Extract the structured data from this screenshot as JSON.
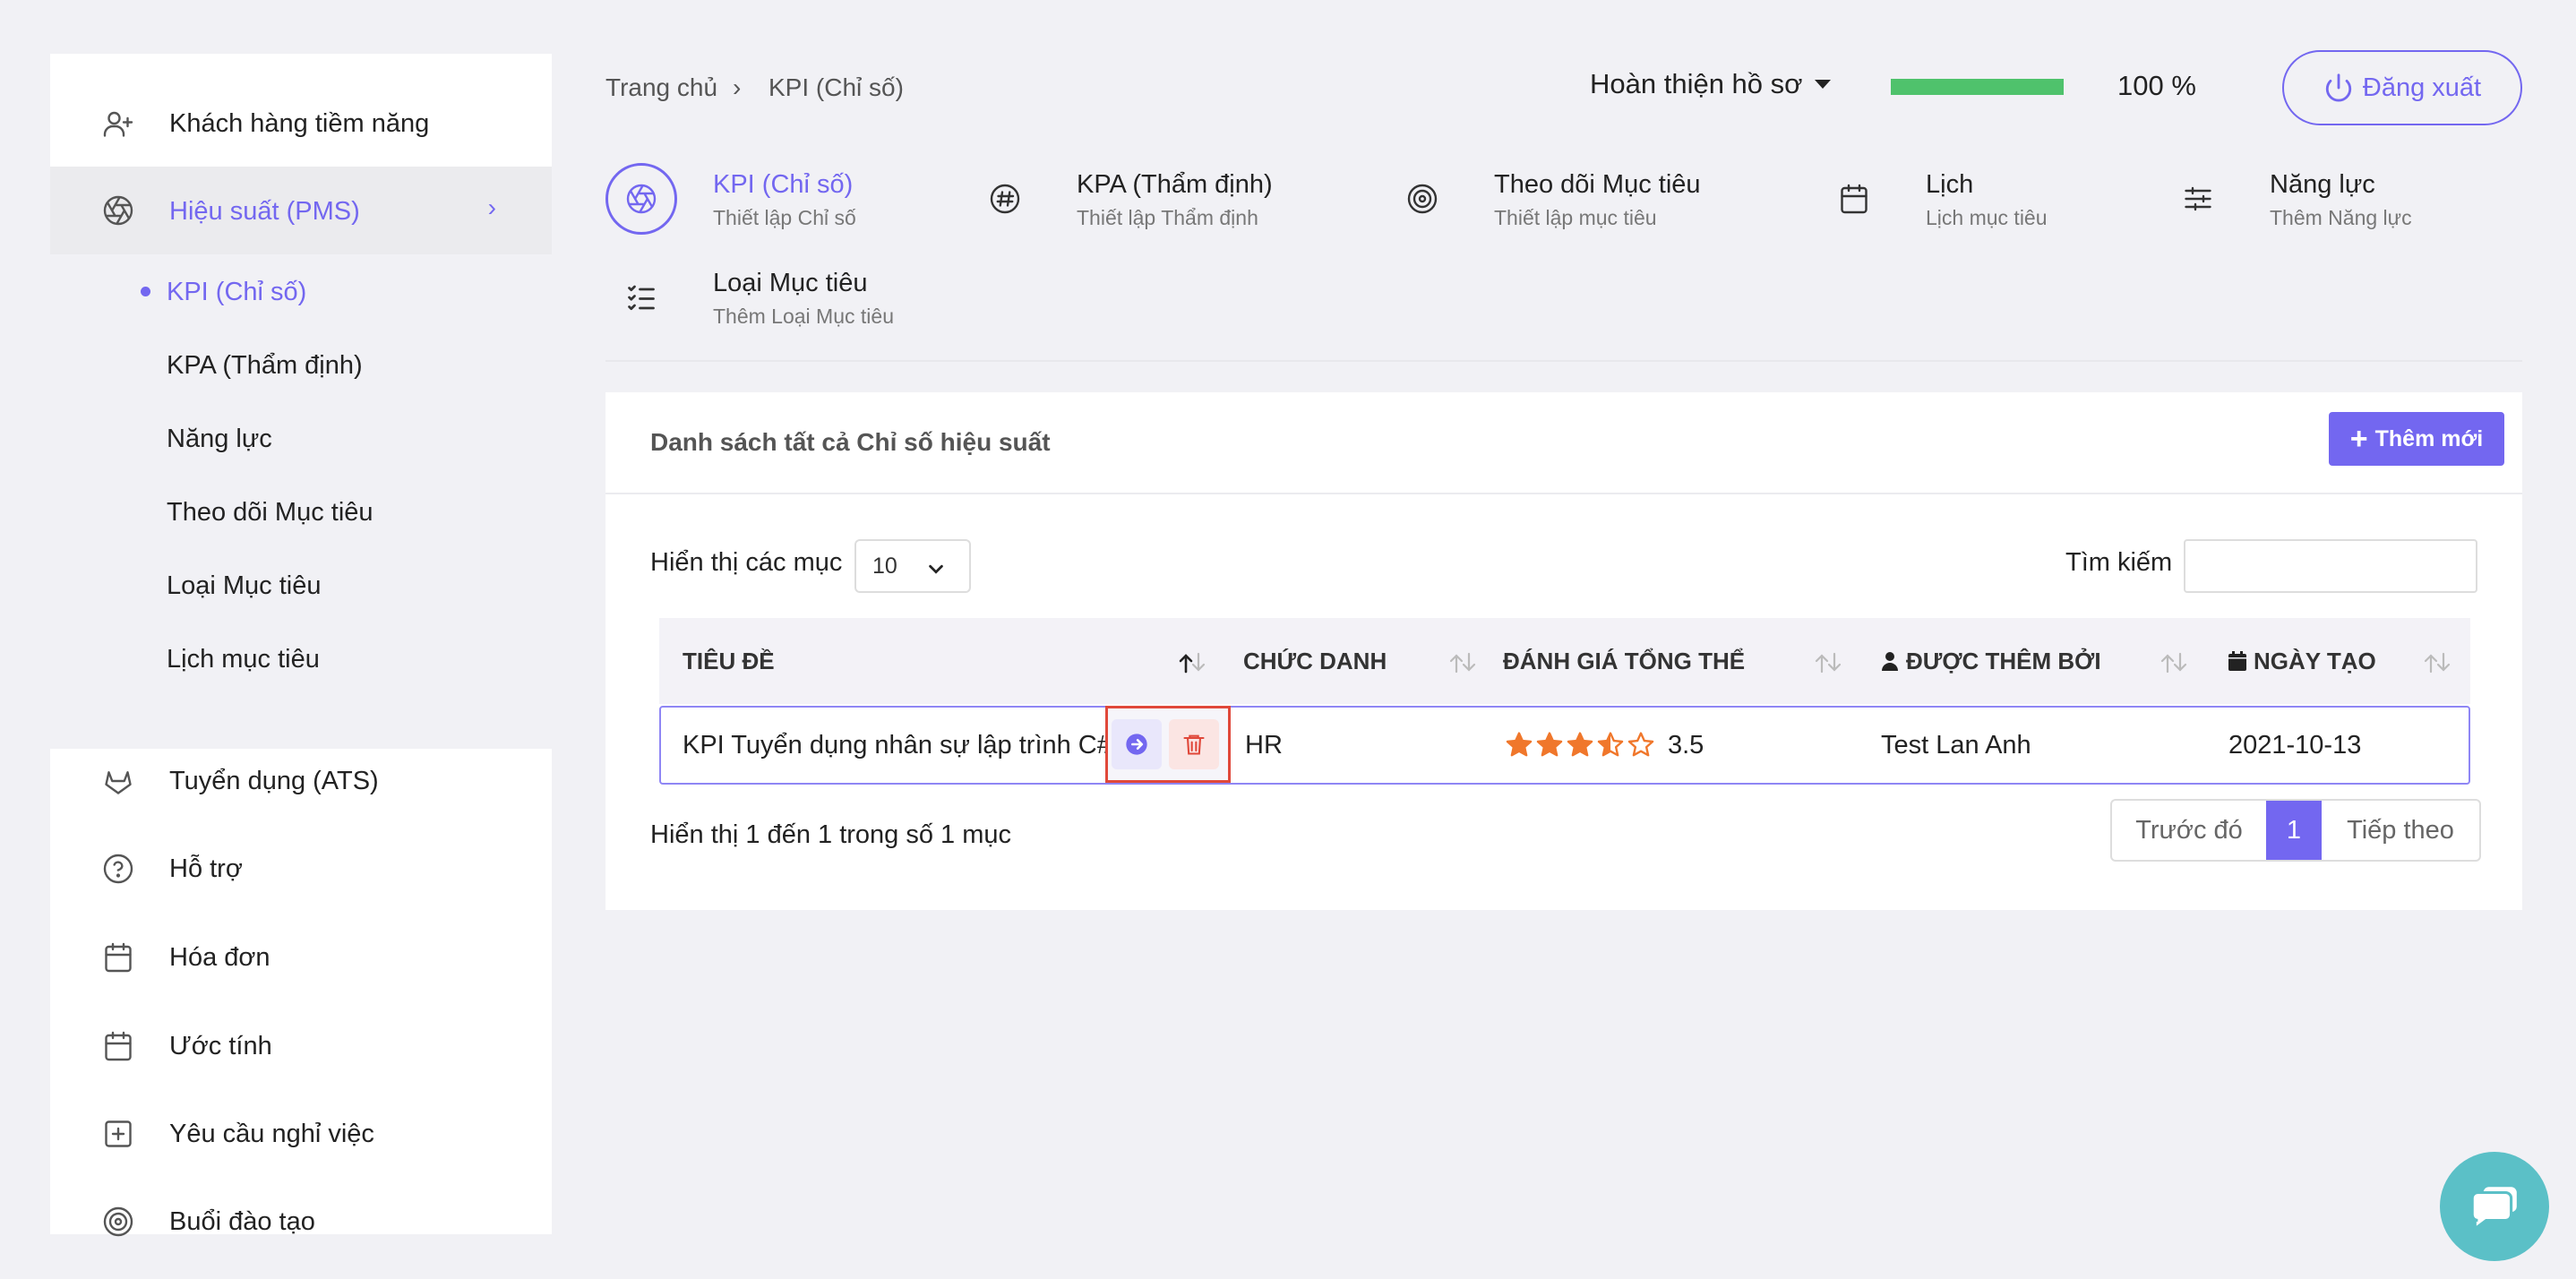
{
  "sidebar": {
    "items": [
      {
        "label": "Khách hàng tiềm năng",
        "icon": "user-plus-icon"
      },
      {
        "label": "Hiệu suất (PMS)",
        "icon": "aperture-icon"
      },
      {
        "label": "Tuyển dụng (ATS)",
        "icon": "gitlab-icon"
      },
      {
        "label": "Hỗ trợ",
        "icon": "help-circle-icon"
      },
      {
        "label": "Hóa đơn",
        "icon": "calendar-icon"
      },
      {
        "label": "Ước tính",
        "icon": "calendar-icon"
      },
      {
        "label": "Yêu cầu nghỉ việc",
        "icon": "plus-square-icon"
      },
      {
        "label": "Buổi đào tạo",
        "icon": "target-icon"
      }
    ],
    "sub_items": [
      {
        "label": "KPI (Chỉ số)"
      },
      {
        "label": "KPA (Thẩm định)"
      },
      {
        "label": "Năng lực"
      },
      {
        "label": "Theo dõi Mục tiêu"
      },
      {
        "label": "Loại Mục tiêu"
      },
      {
        "label": "Lịch mục tiêu"
      }
    ]
  },
  "breadcrumb": {
    "home": "Trang chủ",
    "separator": "›",
    "current": "KPI (Chỉ số)"
  },
  "header": {
    "profile_label": "Hoàn thiện hồ sơ",
    "progress_fraction": 1.0,
    "progress_text": "100 %",
    "logout_label": "Đăng xuất"
  },
  "tabs": [
    {
      "title": "KPI (Chỉ số)",
      "subtitle": "Thiết lập Chỉ số",
      "icon": "aperture-icon"
    },
    {
      "title": "KPA (Thẩm định)",
      "subtitle": "Thiết lập Thẩm định",
      "icon": "hash-icon"
    },
    {
      "title": "Theo dõi Mục tiêu",
      "subtitle": "Thiết lập mục tiêu",
      "icon": "target-icon"
    },
    {
      "title": "Lịch",
      "subtitle": "Lịch mục tiêu",
      "icon": "calendar-icon"
    },
    {
      "title": "Năng lực",
      "subtitle": "Thêm Năng lực",
      "icon": "sliders-icon"
    },
    {
      "title": "Loại Mục tiêu",
      "subtitle": "Thêm Loại Mục tiêu",
      "icon": "list-check-icon"
    }
  ],
  "card": {
    "title": "Danh sách tất cả Chỉ số hiệu suất",
    "add_label": "Thêm mới",
    "show_label": "Hiển thị các mục",
    "page_size": "10",
    "search_label": "Tìm kiếm",
    "search_value": ""
  },
  "table": {
    "columns": [
      "TIÊU ĐỀ",
      "CHỨC DANH",
      "ĐÁNH GIÁ TỔNG THỂ",
      "ĐƯỢC THÊM BỞI",
      "NGÀY TẠO"
    ],
    "rows": [
      {
        "title": "KPI Tuyển dụng nhân sự lập trình C#",
        "position": "HR",
        "rating": 3.5,
        "rating_text": "3.5",
        "added_by": "Test Lan Anh",
        "created": "2021-10-13"
      }
    ]
  },
  "footer": {
    "info": "Hiển thị 1 đến 1 trong số 1 mục",
    "prev": "Trước đó",
    "page": "1",
    "next": "Tiếp theo"
  },
  "colors": {
    "accent": "#7367f0",
    "progress": "#4fc26c",
    "star": "#f0772b",
    "danger": "#e0483a",
    "chat": "#5bc0c7"
  }
}
